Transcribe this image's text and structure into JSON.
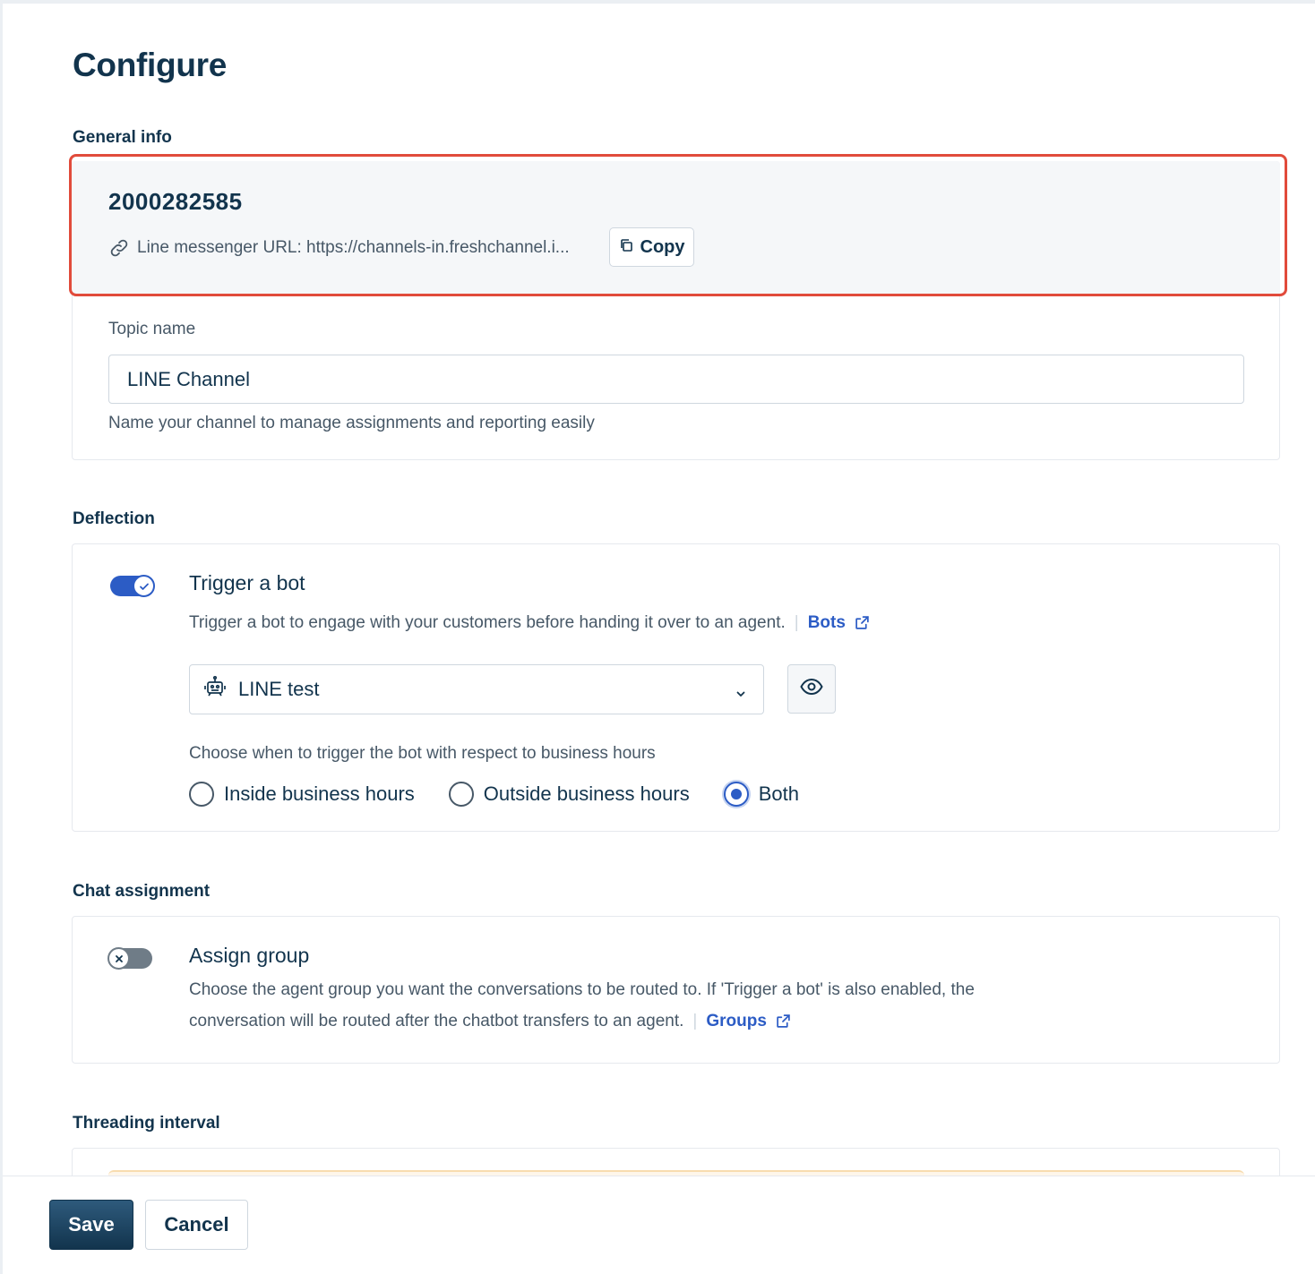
{
  "page": {
    "title": "Configure"
  },
  "general_info": {
    "label": "General info",
    "channel_id": "2000282585",
    "url_text": "Line messenger URL: https://channels-in.freshchannel.i...",
    "copy_label": "Copy",
    "topic_label": "Topic name",
    "topic_value": "LINE Channel",
    "topic_helper": "Name your channel to manage assignments and reporting easily"
  },
  "deflection": {
    "label": "Deflection",
    "toggle_state": "on",
    "title": "Trigger a bot",
    "description": "Trigger a bot to engage with your customers before handing it over to an agent.",
    "link_label": "Bots",
    "selected_bot": "LINE test",
    "hours_prompt": "Choose when to trigger the bot with respect to business hours",
    "radio_options": [
      "Inside business hours",
      "Outside business hours",
      "Both"
    ],
    "selected_option": "Both"
  },
  "chat_assignment": {
    "label": "Chat assignment",
    "toggle_state": "off",
    "title": "Assign group",
    "description_line1": "Choose the agent group you want the conversations to be routed to. If 'Trigger a bot' is also enabled, the",
    "description_line2": "conversation will be routed after the chatbot transfers to an agent.",
    "link_label": "Groups"
  },
  "threading": {
    "label": "Threading interval"
  },
  "footer": {
    "save_label": "Save",
    "cancel_label": "Cancel"
  },
  "colors": {
    "primary_text": "#12344d",
    "secondary_text": "#475867",
    "accent_blue": "#2c5cc5",
    "highlight_border": "#e14b3b",
    "card_tint": "#f5f7f9"
  },
  "icons": [
    "link-icon",
    "copy-icon",
    "check-icon",
    "external-link-icon",
    "bot-icon",
    "chevron-down-icon",
    "eye-icon",
    "close-icon"
  ]
}
